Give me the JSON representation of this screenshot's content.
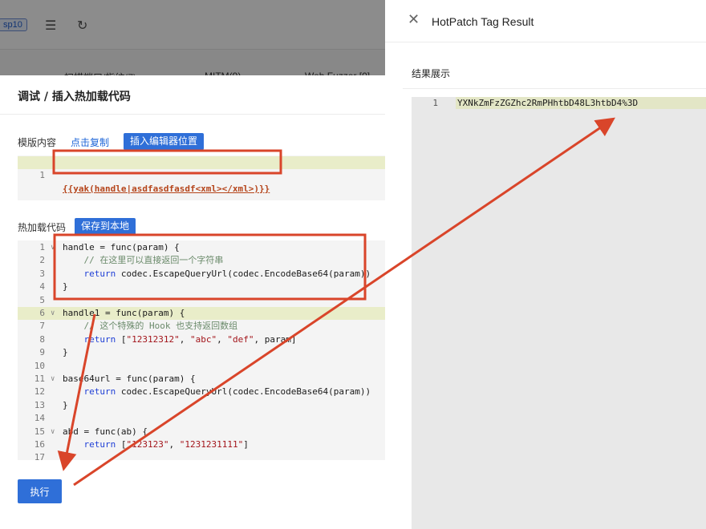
{
  "background": {
    "tag": "sp10",
    "tabs": [
      "扫描端口/指纹(7)",
      "MITM(9)",
      "Web Fuzzer [0]"
    ]
  },
  "modal": {
    "title": "调试 / 插入热加载代码",
    "template_label": "模版内容",
    "copy_link": "点击复制",
    "insert_button": "插入编辑器位置",
    "template_lines": [
      {
        "n": "1",
        "text": "{{yak(handle|asdfasdfasdf<xml></xml>)}}"
      }
    ],
    "hotload_label": "热加载代码",
    "save_button": "保存到本地",
    "code_lines": [
      {
        "n": "1",
        "fold": "∨"
      },
      {
        "n": "2"
      },
      {
        "n": "3"
      },
      {
        "n": "4"
      },
      {
        "n": "5"
      },
      {
        "n": "6",
        "fold": "∨"
      },
      {
        "n": "7"
      },
      {
        "n": "8"
      },
      {
        "n": "9"
      },
      {
        "n": "10"
      },
      {
        "n": "11",
        "fold": "∨"
      },
      {
        "n": "12"
      },
      {
        "n": "13"
      },
      {
        "n": "14"
      },
      {
        "n": "15",
        "fold": "∨"
      },
      {
        "n": "16"
      },
      {
        "n": "17"
      }
    ],
    "code": {
      "l1": "handle = func(param) {",
      "l2_comment": "// 在这里可以直接返回一个字符串",
      "l3_kw": "return",
      "l3_rest": " codec.EscapeQueryUrl(codec.EncodeBase64(param))",
      "l4": "}",
      "l6": "handle1 = func(param) {",
      "l7_comment": "// 这个特殊的 Hook 也支持返回数组",
      "l8_kw": "return",
      "l8_a": " [",
      "l8_s1": "\"12312312\"",
      "l8_c1": ", ",
      "l8_s2": "\"abc\"",
      "l8_c2": ", ",
      "l8_s3": "\"def\"",
      "l8_b": ", param]",
      "l9": "}",
      "l11": "base64url = func(param) {",
      "l12_kw": "return",
      "l12_rest": " codec.EscapeQueryUrl(codec.EncodeBase64(param))",
      "l13": "}",
      "l15": "abd = func(ab) {",
      "l16_kw": "return",
      "l16_a": " [",
      "l16_s1": "\"123123\"",
      "l16_c": ", ",
      "l16_s2": "\"1231231111\"",
      "l16_b": "]"
    },
    "run_button": "执行"
  },
  "drawer": {
    "title": "HotPatch Tag Result",
    "result_label": "结果展示",
    "result_line_number": "1",
    "result_text": "YXNkZmFzZGZhc2RmPHhtbD48L3htbD4%3D"
  },
  "annotation_color": "#d9452a"
}
